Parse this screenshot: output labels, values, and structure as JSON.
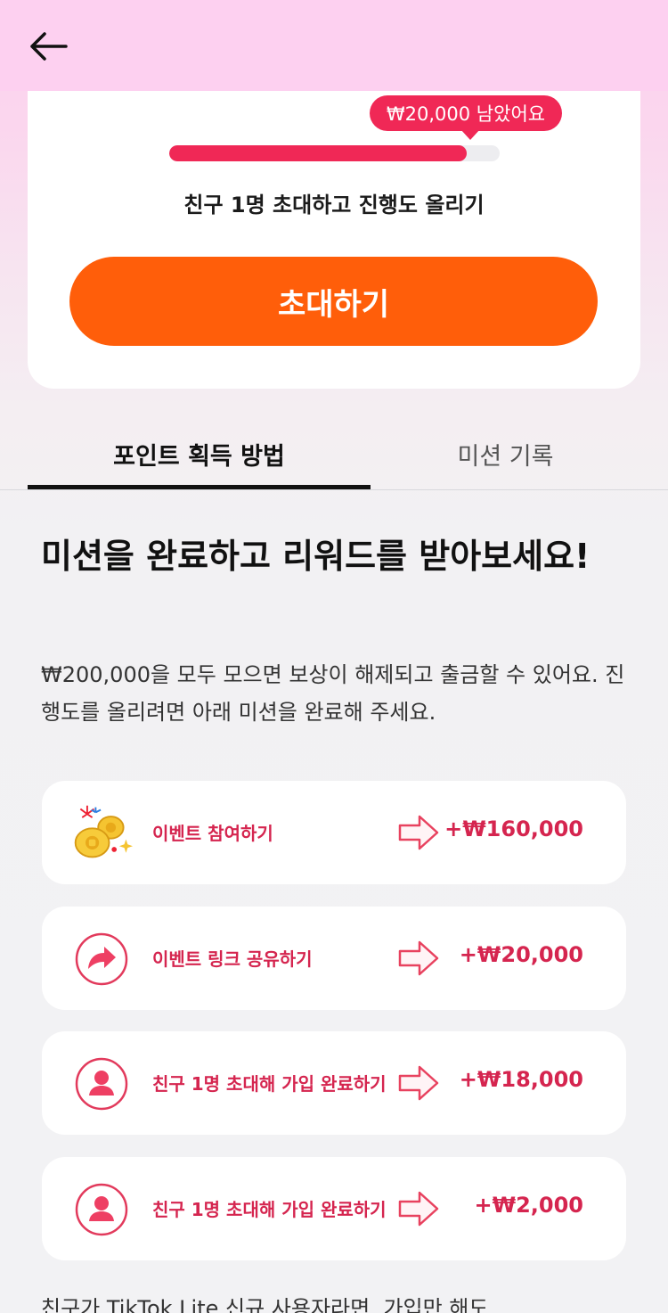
{
  "header": {
    "back_icon": "arrow-left-icon"
  },
  "progress": {
    "remaining_label": "₩20,000 남았어요",
    "fraction": 0.9,
    "description": "친구 1명 초대하고 진행도 올리기",
    "invite_button_label": "초대하기"
  },
  "tabs": [
    {
      "label": "포인트 획득 방법",
      "active": true
    },
    {
      "label": "미션 기록",
      "active": false
    }
  ],
  "main": {
    "title": "미션을 완료하고 리워드를 받아보세요!",
    "description": "₩200,000을 모두 모으면 보상이 해제되고 출금할 수 있어요. 진행도를 올리려면 아래 미션을 완료해 주세요."
  },
  "missions": [
    {
      "label": "이벤트 참여하기",
      "reward": "+₩160,000",
      "icon": "coins-fireworks-icon"
    },
    {
      "label": "이벤트 링크 공유하기",
      "reward": "+₩20,000",
      "icon": "share-arrow-icon"
    },
    {
      "label": "친구 1명 초대해 가입 완료하기",
      "reward": "+₩18,000",
      "icon": "user-icon"
    },
    {
      "label": "친구 1명 초대해 가입 완료하기",
      "reward": "+₩2,000",
      "icon": "user-icon"
    }
  ],
  "footer": {
    "text": "친구가 TikTok Lite 신규 사용자라면, 가입만 해도"
  },
  "colors": {
    "accent": "#f02856",
    "button": "#ff5e0a",
    "mission_text": "#d5254f"
  }
}
